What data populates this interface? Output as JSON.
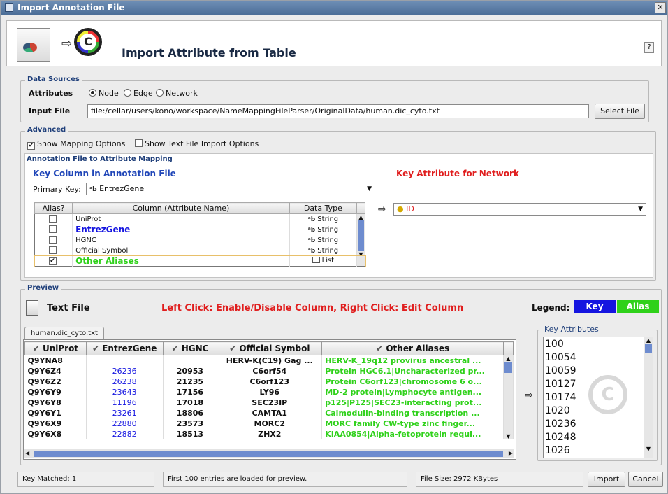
{
  "window": {
    "title": "Import Annotation File",
    "close_glyph": "✕",
    "help_glyph": "?"
  },
  "header": {
    "title": "Import Attribute from Table"
  },
  "data_sources": {
    "legend": "Data Sources",
    "attributes_label": "Attributes",
    "options": [
      "Node",
      "Edge",
      "Network"
    ],
    "selected": "Node",
    "input_file_label": "Input File",
    "input_file_value": "file:/cellar/users/kono/workspace/NameMappingFileParser/OriginalData/human.dic_cyto.txt",
    "select_file_label": "Select File"
  },
  "advanced": {
    "legend": "Advanced",
    "show_mapping_label": "Show Mapping Options",
    "show_mapping_checked": true,
    "show_text_import_label": "Show Text File Import Options",
    "show_text_import_checked": false
  },
  "mapping": {
    "title": "Annotation File to Attribute Mapping",
    "key_column_title": "Key Column in Annotation File",
    "key_attribute_title": "Key Attribute for Network",
    "primary_key_label": "Primary Key:",
    "primary_key_value": "EntrezGene",
    "key_attribute_value": "ID",
    "columns": [
      "Alias?",
      "Column (Attribute Name)",
      "Data Type"
    ],
    "rows": [
      {
        "alias": false,
        "name": "UniProt",
        "type": "String",
        "style": "normal"
      },
      {
        "alias": false,
        "name": "EntrezGene",
        "type": "String",
        "style": "key"
      },
      {
        "alias": false,
        "name": "HGNC",
        "type": "String",
        "style": "normal"
      },
      {
        "alias": false,
        "name": "Official Symbol",
        "type": "String",
        "style": "normal"
      },
      {
        "alias": true,
        "name": "Other Aliases",
        "type": "List",
        "style": "alias"
      }
    ]
  },
  "preview": {
    "legend": "Preview",
    "text_file_label": "Text File",
    "hint": "Left Click: Enable/Disable Column, Right Click: Edit Column",
    "legend_label": "Legend:",
    "legend_key": "Key",
    "legend_alias": "Alias",
    "tab_label": "human.dic_cyto.txt",
    "columns": [
      "UniProt",
      "EntrezGene",
      "HGNC",
      "Official Symbol",
      "Other Aliases"
    ],
    "rows": [
      [
        "Q9YNA8",
        "",
        "",
        "HERV-K(C19) Gag ...",
        "HERV-K_19q12 provirus ancestral ..."
      ],
      [
        "Q9Y6Z4",
        "26236",
        "20953",
        "C6orf54",
        "Protein HGC6.1|Uncharacterized pr..."
      ],
      [
        "Q9Y6Z2",
        "26238",
        "21235",
        "C6orf123",
        "Protein C6orf123|chromosome 6 o..."
      ],
      [
        "Q9Y6Y9",
        "23643",
        "17156",
        "LY96",
        "MD-2 protein|Lymphocyte antigen..."
      ],
      [
        "Q9Y6Y8",
        "11196",
        "17018",
        "SEC23IP",
        "p125|P125|SEC23-interacting prot..."
      ],
      [
        "Q9Y6Y1",
        "23261",
        "18806",
        "CAMTA1",
        "Calmodulin-binding transcription ..."
      ],
      [
        "Q9Y6X9",
        "22880",
        "23573",
        "MORC2",
        "MORC family CW-type zinc finger..."
      ],
      [
        "Q9Y6X8",
        "22882",
        "18513",
        "ZHX2",
        "KIAA0854|Alpha-fetoprotein requl..."
      ]
    ],
    "key_attributes_title": "Key Attributes",
    "key_attributes": [
      "100",
      "10054",
      "10059",
      "10127",
      "10174",
      "1020",
      "10236",
      "10248",
      "1026"
    ]
  },
  "status": {
    "key_matched": "Key Matched: 1",
    "loaded": "First 100 entries are loaded for preview.",
    "file_size": "File Size: 2972 KBytes",
    "import_label": "Import",
    "cancel_label": "Cancel"
  },
  "colors": {
    "key": "#1515e0",
    "alias": "#2fd11a",
    "hint": "#e01e1e",
    "section": "#1f3f7a"
  }
}
